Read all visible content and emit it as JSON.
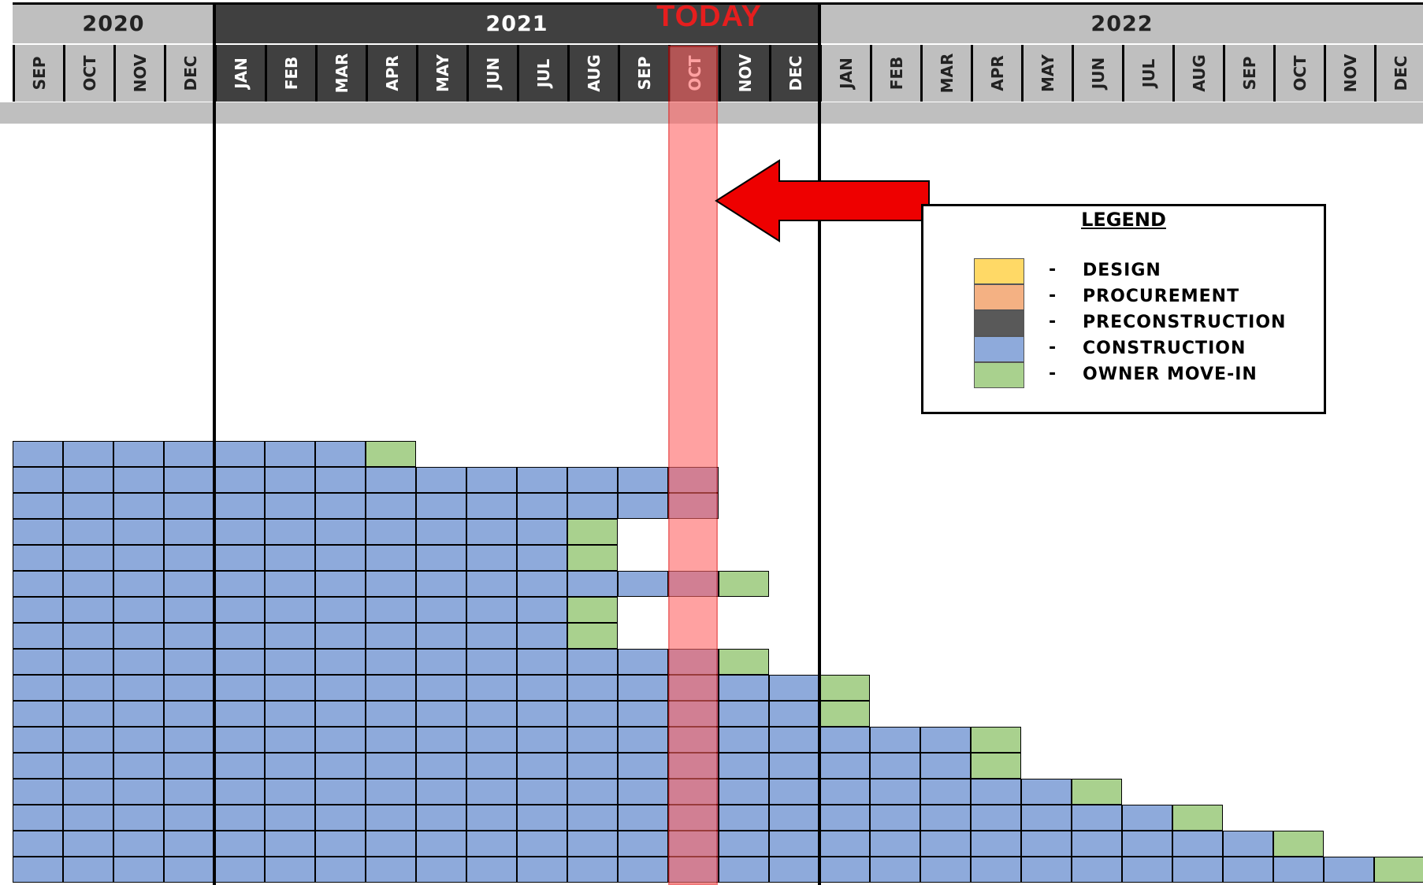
{
  "chart_data": {
    "type": "gantt",
    "years": [
      {
        "label": "2020",
        "months": 4,
        "bg": "#bfbfbf",
        "color": "#222222"
      },
      {
        "label": "2021",
        "months": 12,
        "bg": "#404040",
        "color": "#ffffff"
      },
      {
        "label": "2022",
        "months": 12,
        "bg": "#bfbfbf",
        "color": "#222222"
      }
    ],
    "months": [
      "SEP",
      "OCT",
      "NOV",
      "DEC",
      "JAN",
      "FEB",
      "MAR",
      "APR",
      "MAY",
      "JUN",
      "JUL",
      "AUG",
      "SEP",
      "OCT",
      "NOV",
      "DEC",
      "JAN",
      "FEB",
      "MAR",
      "APR",
      "MAY",
      "JUN",
      "JUL",
      "AUG",
      "SEP",
      "OCT",
      "NOV",
      "DEC"
    ],
    "today": {
      "label": "TODAY",
      "month_index": 13,
      "month": "OCT 2021"
    },
    "phases": {
      "design": "#ffd966",
      "procurement": "#f4b183",
      "preconstruction": "#595959",
      "construction": "#8eaadb",
      "move_in": "#a9d18e"
    },
    "rows": [
      {
        "construction": [
          0,
          7
        ],
        "move_in": [
          7,
          8
        ]
      },
      {
        "construction": [
          0,
          14
        ]
      },
      {
        "construction": [
          0,
          14
        ]
      },
      {
        "construction": [
          0,
          11
        ],
        "move_in": [
          11,
          12
        ]
      },
      {
        "construction": [
          0,
          11
        ],
        "move_in": [
          11,
          12
        ]
      },
      {
        "construction": [
          0,
          14
        ],
        "move_in": [
          14,
          15
        ]
      },
      {
        "construction": [
          0,
          11
        ],
        "move_in": [
          11,
          12
        ]
      },
      {
        "construction": [
          0,
          11
        ],
        "move_in": [
          11,
          12
        ]
      },
      {
        "construction": [
          0,
          14
        ],
        "move_in": [
          14,
          15
        ]
      },
      {
        "construction": [
          0,
          16
        ],
        "move_in": [
          16,
          17
        ]
      },
      {
        "construction": [
          0,
          16
        ],
        "move_in": [
          16,
          17
        ]
      },
      {
        "construction": [
          0,
          19
        ],
        "move_in": [
          19,
          20
        ]
      },
      {
        "construction": [
          0,
          19
        ],
        "move_in": [
          19,
          20
        ]
      },
      {
        "construction": [
          0,
          21
        ],
        "move_in": [
          21,
          22
        ]
      },
      {
        "construction": [
          0,
          23
        ],
        "move_in": [
          23,
          24
        ]
      },
      {
        "construction": [
          0,
          25
        ],
        "move_in": [
          25,
          26
        ]
      },
      {
        "construction": [
          0,
          27
        ],
        "move_in": [
          27,
          28
        ]
      }
    ],
    "legend": {
      "title": "LEGEND",
      "placement": "top-right",
      "items": [
        {
          "key": "design",
          "label": "DESIGN"
        },
        {
          "key": "procurement",
          "label": "PROCUREMENT"
        },
        {
          "key": "preconstruction",
          "label": "PRECONSTRUCTION"
        },
        {
          "key": "construction",
          "label": "CONSTRUCTION"
        },
        {
          "key": "move_in",
          "label": "OWNER MOVE-IN"
        }
      ],
      "dash": "-"
    },
    "colors": {
      "today_band": "#ff6464",
      "today_text": "#e61e1e",
      "arrow": "#ee0000",
      "header_strip": "#bfbfbf"
    }
  }
}
